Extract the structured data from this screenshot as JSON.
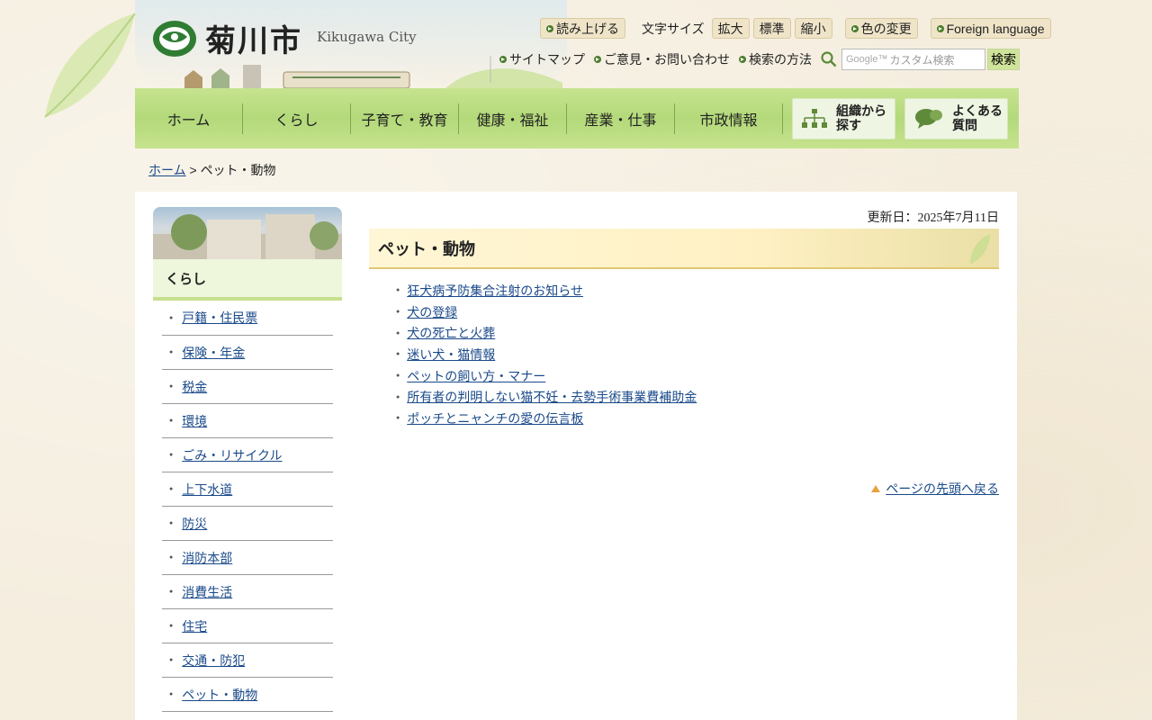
{
  "header": {
    "city_name": "菊川市",
    "city_name_en": "Kikugawa City",
    "util": {
      "read_aloud": "読み上げる",
      "font_size_label": "文字サイズ",
      "font_large": "拡大",
      "font_standard": "標準",
      "font_small": "縮小",
      "color_change": "色の変更",
      "foreign_language": "Foreign language"
    },
    "links": {
      "sitemap": "サイトマップ",
      "contact": "ご意見・お問い合わせ",
      "search_help": "検索の方法"
    },
    "search": {
      "placeholder": "カスタム検索",
      "google_label": "Google™",
      "button": "検索"
    }
  },
  "gnav": {
    "items": [
      "ホーム",
      "くらし",
      "子育て・教育",
      "健康・福祉",
      "産業・仕事",
      "市政情報"
    ],
    "org_search": [
      "組織から",
      "探す"
    ],
    "faq": [
      "よくある",
      "質問"
    ]
  },
  "breadcrumb": {
    "home": "ホーム",
    "separator": ">",
    "current": "ペット・動物"
  },
  "sidebar": {
    "title": "くらし",
    "items": [
      "戸籍・住民票",
      "保険・年金",
      "税金",
      "環境",
      "ごみ・リサイクル",
      "上下水道",
      "防災",
      "消防本部",
      "消費生活",
      "住宅",
      "交通・防犯",
      "ペット・動物"
    ]
  },
  "main": {
    "updated": "更新日：2025年7月11日",
    "title": "ペット・動物",
    "links": [
      "狂犬病予防集合注射のお知らせ",
      "犬の登録",
      "犬の死亡と火葬",
      "迷い犬・猫情報",
      "ペットの飼い方・マナー",
      "所有者の判明しない猫不妊・去勢手術事業費補助金",
      "ポッチとニャンチの愛の伝言板"
    ],
    "to_top": "ページの先頭へ戻る"
  },
  "colors": {
    "nav_green": "#b3d97a",
    "link_blue": "#1a4a8a",
    "heading_yellow": "#fff1c4",
    "accent_orange": "#e6a23c"
  }
}
